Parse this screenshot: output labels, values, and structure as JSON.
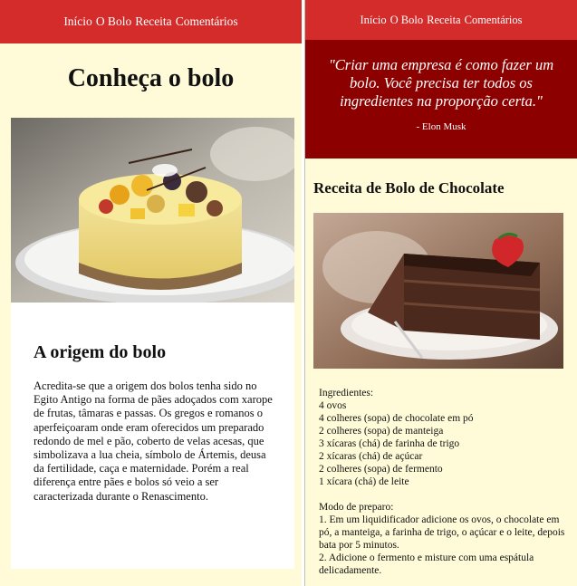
{
  "left": {
    "nav": [
      "Início",
      "O Bolo",
      "Receita",
      "Comentários"
    ],
    "page_title": "Conheça o bolo",
    "origin": {
      "title": "A origem do bolo",
      "text": "Acredita-se que a origem dos bolos tenha sido no Egito Antigo na forma de pães adoçados com xarope de frutas, tâmaras e passas. Os gregos e romanos o aperfeiçoaram onde eram oferecidos um preparado redondo de mel e pão, coberto de velas acesas, que simbolizava a lua cheia, símbolo de Ártemis, deusa da fertilidade, caça e maternidade. Porém a real diferença entre pães e bolos só veio a ser caracterizada durante o Renascimento."
    }
  },
  "right": {
    "nav": [
      "Início",
      "O Bolo",
      "Receita",
      "Comentários"
    ],
    "quote": {
      "text": "\"Criar uma empresa é como fazer um bolo. Você precisa ter todos os ingredientes na proporção certa.\"",
      "author": "- Elon Musk"
    },
    "recipe": {
      "title": "Receita de Bolo de Chocolate",
      "ingredients_label": "Ingredientes:",
      "ingredients": [
        "4 ovos",
        "4 colheres (sopa) de chocolate em pó",
        "2 colheres (sopa) de manteiga",
        "3 xícaras (chá) de farinha de trigo",
        "2 xícaras (chá) de açúcar",
        "2 colheres (sopa) de fermento",
        "1 xícara (chá) de leite"
      ],
      "method_label": "Modo de preparo:",
      "steps": [
        "1. Em um liquidificador adicione os ovos, o chocolate em pó, a manteiga, a farinha de trigo, o açúcar e o leite, depois bata por 5 minutos.",
        "2. Adicione o fermento e misture com uma espátula delicadamente."
      ]
    }
  },
  "colors": {
    "navbar": "#d42b2b",
    "quote_bg": "#8c0000",
    "page_bg": "#fffbd8"
  }
}
